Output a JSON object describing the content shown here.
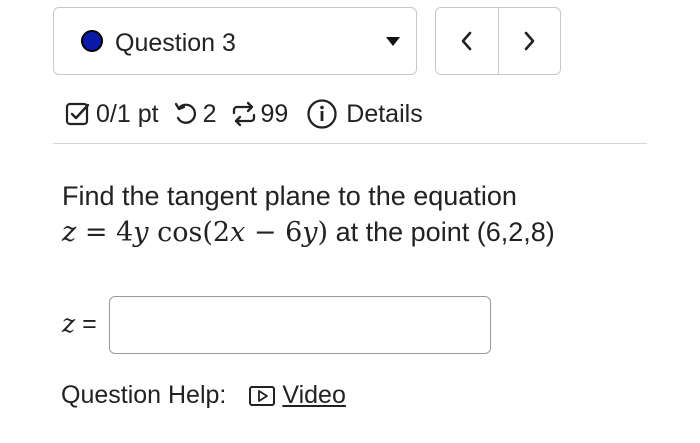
{
  "question_selector": {
    "label": "Question 3",
    "status_color": "#0a1aa8"
  },
  "nav": {
    "prev_icon": "chevron-left-icon",
    "next_icon": "chevron-right-icon"
  },
  "status": {
    "score": "0/1 pt",
    "attempts": "2",
    "tries": "99",
    "details_label": "Details",
    "score_icon": "checkbox-icon",
    "attempts_icon": "retry-icon",
    "tries_icon": "repeat-icon",
    "details_icon": "info-icon"
  },
  "question": {
    "text_line1": "Find the tangent plane to the equation",
    "equation_lhs": "z",
    "equation_rhs_coef": "4",
    "equation_rhs_var": "y",
    "equation_func": "cos",
    "equation_arg_coef1": "2",
    "equation_arg_var1": "x",
    "equation_minus": "−",
    "equation_arg_coef2": "6",
    "equation_arg_var2": "y",
    "text_line2": "at the point (6,2,8)"
  },
  "answer": {
    "label": "z",
    "equals": "=",
    "value": "",
    "placeholder": ""
  },
  "help": {
    "label": "Question Help:",
    "video_label": "Video",
    "video_icon": "play-icon"
  }
}
